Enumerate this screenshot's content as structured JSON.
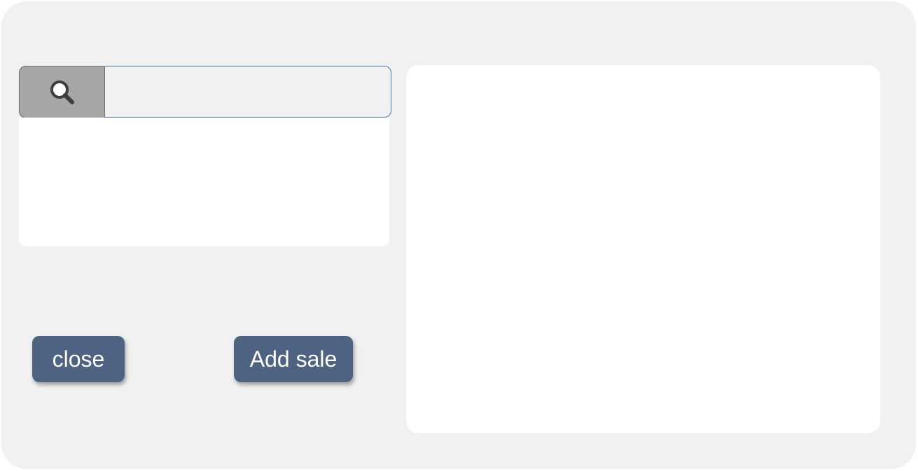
{
  "search": {
    "value": "",
    "placeholder": "",
    "button_icon": "search-icon"
  },
  "results": {
    "items": []
  },
  "detail": {
    "content": ""
  },
  "buttons": {
    "close_label": "close",
    "add_sale_label": "Add sale"
  },
  "colors": {
    "background": "#f1f1f1",
    "panel": "#ffffff",
    "button": "#4e6282",
    "search_button": "#a6a6a6",
    "search_border": "#4a7aa8"
  }
}
